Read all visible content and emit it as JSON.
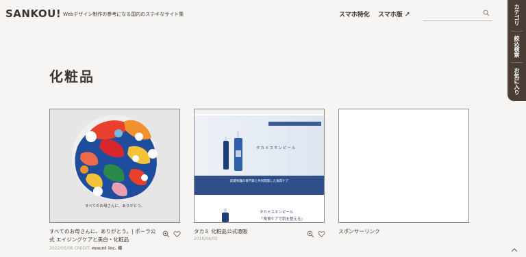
{
  "header": {
    "logo": "SANKOU!",
    "tagline": "Webデザイン制作の参考になる国内のステキなサイト集",
    "nav": [
      {
        "label": "スマホ特化"
      },
      {
        "label": "スマホ版 ↗"
      }
    ],
    "search": {
      "value": "",
      "icon": "search-icon"
    }
  },
  "side_menu": [
    {
      "label": "カテゴリ"
    },
    {
      "label": "絞込検索"
    },
    {
      "label": "お気に入り"
    }
  ],
  "page_title": "化粧品",
  "cards": [
    {
      "title": "すべてのお母さんに、ありがとう。| ポーラ公式 エイジングケアと美白・化粧品",
      "date": "2022/05/08",
      "credit_label": "CREDIT:",
      "credit_value": "mount inc. 様",
      "thumb_caption": "すべてのお母さんに、ありがとう。"
    },
    {
      "title": "タカミ 化粧品公式通販",
      "date": "2016/06/02",
      "thumb_heading": "タカミスキンピール",
      "thumb_band": "皮膚保護の専門家と共同開発した角質ケア",
      "thumb_bottom": "タカミスキンピール",
      "thumb_bottom2": "「角質ケアで肌を整える」"
    },
    {
      "title": "スポンサーリンク"
    }
  ],
  "colors": {
    "background": "#f6f5f3",
    "text": "#3d3530",
    "side_menu_bg": "#4a3d36"
  }
}
